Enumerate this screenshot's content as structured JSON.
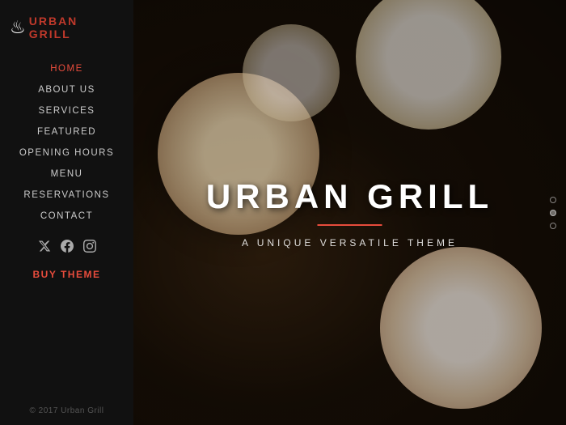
{
  "logo": {
    "text_urban": "URBAN",
    "text_grill": "GRILL",
    "icon": "♨"
  },
  "nav": {
    "items": [
      {
        "label": "HOME",
        "active": true
      },
      {
        "label": "ABOUT US",
        "active": false
      },
      {
        "label": "SERVICES",
        "active": false
      },
      {
        "label": "FEATURED",
        "active": false
      },
      {
        "label": "OPENING HOURS",
        "active": false
      },
      {
        "label": "MENU",
        "active": false
      },
      {
        "label": "RESERVATIONS",
        "active": false
      },
      {
        "label": "CONTACT",
        "active": false
      }
    ]
  },
  "social": {
    "twitter": "𝕏",
    "facebook": "f",
    "instagram": "ℊ"
  },
  "buy_label": "BUY THEME",
  "footer_copy": "© 2017 Urban Grill",
  "hero": {
    "title": "URBAN GRILL",
    "subtitle": "A UNIQUE VERSATILE THEME"
  },
  "scroll_dots": [
    "dot1",
    "dot2",
    "dot3"
  ]
}
